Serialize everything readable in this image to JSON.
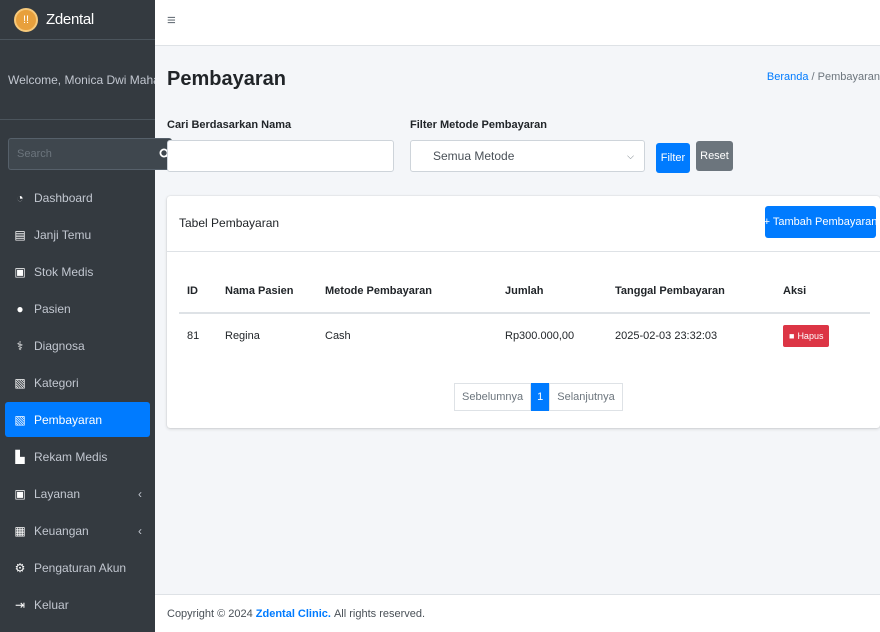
{
  "brand": {
    "logo_text": "!!",
    "name": "Zdental"
  },
  "user": {
    "welcome": "Welcome, Monica Dwi Maharan"
  },
  "sidebar": {
    "search_placeholder": "Search",
    "items": [
      {
        "label": "Dashboard",
        "icon": "dashboard-icon",
        "glyph": "◔"
      },
      {
        "label": "Janji Temu",
        "icon": "calendar-icon",
        "glyph": "▤"
      },
      {
        "label": "Stok Medis",
        "icon": "medicine-icon",
        "glyph": "▣"
      },
      {
        "label": "Pasien",
        "icon": "user-icon",
        "glyph": "●"
      },
      {
        "label": "Diagnosa",
        "icon": "stethoscope-icon",
        "glyph": "⚕"
      },
      {
        "label": "Kategori",
        "icon": "category-icon",
        "glyph": "▧"
      },
      {
        "label": "Pembayaran",
        "icon": "payment-icon",
        "glyph": "▧"
      },
      {
        "label": "Rekam Medis",
        "icon": "file-icon",
        "glyph": "▙"
      },
      {
        "label": "Layanan",
        "icon": "service-icon",
        "glyph": "▣",
        "caret": "‹"
      },
      {
        "label": "Keuangan",
        "icon": "money-icon",
        "glyph": "▦",
        "caret": "‹"
      },
      {
        "label": "Pengaturan Akun",
        "icon": "users-cog-icon",
        "glyph": "⚙"
      },
      {
        "label": "Keluar",
        "icon": "logout-icon",
        "glyph": "⇥"
      }
    ],
    "active_index": 6
  },
  "topbar": {
    "menu_glyph": "≡"
  },
  "page": {
    "title": "Pembayaran",
    "breadcrumb_home": "Beranda",
    "breadcrumb_sep": " / ",
    "breadcrumb_current": "Pembayaran"
  },
  "filters": {
    "name_label": "Cari Berdasarkan Nama",
    "name_value": "",
    "method_label": "Filter Metode Pembayaran",
    "method_selected": "Semua Metode",
    "filter_button": "Filter",
    "reset_button": "Reset"
  },
  "table_card": {
    "title": "Tabel Pembayaran",
    "add_button": "+ Tambah Pembayaran",
    "headers": [
      "ID",
      "Nama Pasien",
      "Metode Pembayaran",
      "Jumlah",
      "Tanggal Pembayaran",
      "Aksi"
    ],
    "rows": [
      {
        "id": "81",
        "nama": "Regina",
        "metode": "Cash",
        "jumlah": "Rp300.000,00",
        "tanggal": "2025-02-03 23:32:03",
        "aksi": "Hapus"
      }
    ]
  },
  "pagination": {
    "prev": "Sebelumnya",
    "current": "1",
    "next": "Selanjutnya"
  },
  "footer": {
    "prefix": "Copyright © 2024",
    "brand": "Zdental Clinic.",
    "suffix": "All rights reserved."
  },
  "colors": {
    "primary": "#007bff",
    "danger": "#dc3545",
    "secondary": "#6c757d",
    "sidebar_bg": "#343a40"
  }
}
